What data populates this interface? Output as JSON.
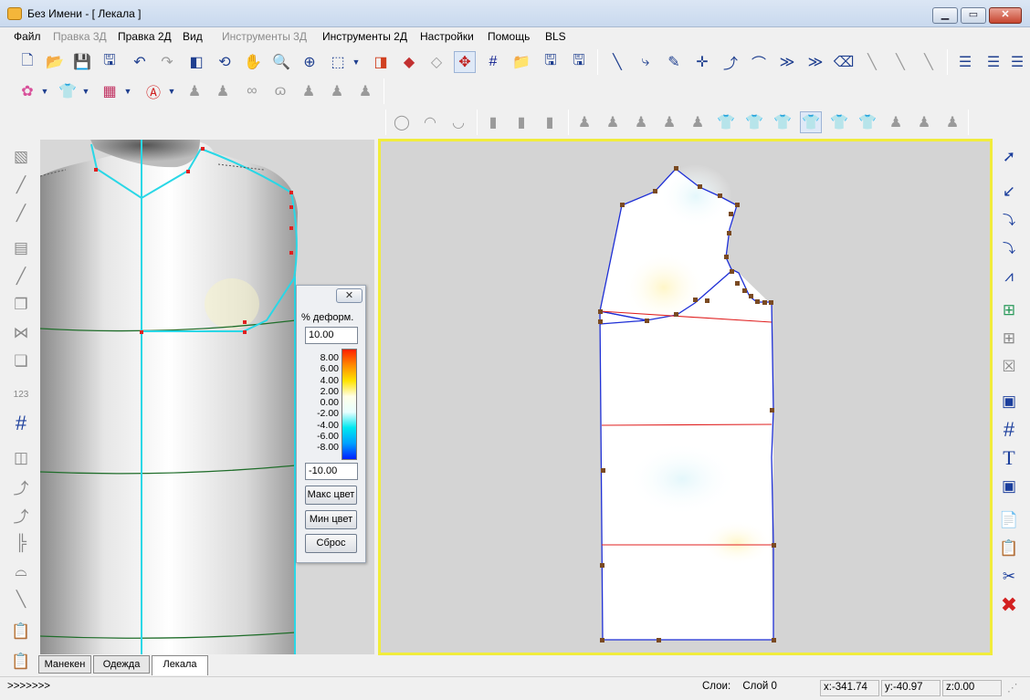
{
  "window": {
    "title": "Без Имени  - [  Лекала  ]",
    "controls": {
      "minimize": "▁",
      "maximize": "▭",
      "close": "✕"
    }
  },
  "menu": [
    {
      "label": "Файл",
      "enabled": true
    },
    {
      "label": "Правка 3Д",
      "enabled": false
    },
    {
      "label": "Правка 2Д",
      "enabled": true
    },
    {
      "label": "Вид",
      "enabled": true
    },
    {
      "label": "Инструменты 3Д",
      "enabled": false
    },
    {
      "label": "Инструменты 2Д",
      "enabled": true
    },
    {
      "label": "Настройки",
      "enabled": true
    },
    {
      "label": "Помощь",
      "enabled": true
    },
    {
      "label": "BLS",
      "enabled": true
    }
  ],
  "deform_panel": {
    "close_label": "✕",
    "label": "% деформ.",
    "max_value": "10.00",
    "min_value": "-10.00",
    "scale_ticks": [
      "8.00",
      "6.00",
      "4.00",
      "2.00",
      "0.00",
      "-2.00",
      "-4.00",
      "-6.00",
      "-8.00"
    ],
    "max_color_button": "Макс цвет",
    "min_color_button": "Мин цвет",
    "reset_button": "Сброс"
  },
  "tabs": [
    {
      "label": "Манекен",
      "active": false
    },
    {
      "label": "Одежда",
      "active": false
    },
    {
      "label": "Лекала",
      "active": true
    }
  ],
  "status": {
    "prompt": ">>>>>>>",
    "layers_label": "Слои:",
    "layer_value": "Слой  0",
    "x": "x:-341.74",
    "y": "y:-40.97",
    "z": "z:0.00"
  },
  "colors": {
    "accent_frame": "#f1ec3c",
    "pattern_outline": "#1e2fd6",
    "grid_line_red": "#e02020",
    "anchor_point": "#7a4a22",
    "mannequin_cut": "#29d7e6"
  },
  "icons": {
    "toolbar1": [
      "new-file-icon",
      "open-folder-icon",
      "save-icon",
      "save-as-icon",
      "undo-icon",
      "redo-icon",
      "view-split-icon",
      "rotate-icon",
      "pan-hand-icon",
      "zoom-icon",
      "zoom-window-icon",
      "view-3d-icon",
      "shading-icon",
      "texture-icon",
      "mesh-icon",
      "move-center-icon",
      "grid-icon",
      "open-tp-icon",
      "save-tp-icon",
      "save-tp-as-icon",
      "line-icon",
      "curve-icon",
      "pencil-icon",
      "point-icon",
      "bezier-add-icon",
      "arc-icon",
      "multi-arc-icon",
      "multi-arc-add-icon",
      "eraser-icon",
      "dart-icon",
      "ruler-icon",
      "ruler2-icon",
      "spacing-icon",
      "spacing2-icon",
      "spacing3-icon"
    ],
    "toolbar2": [
      "flower-material-icon",
      "shirt-icon",
      "color-grid-icon",
      "avatar-icon",
      "body-torso-icon",
      "body-torso2-icon",
      "body-bra-icon",
      "body-hips-icon",
      "body-leg-icon",
      "body-arm-icon",
      "body-full-icon"
    ],
    "toolbar3": [
      "collar-icon",
      "collar2-icon",
      "collar3-icon",
      "pants-icon",
      "pants2-icon",
      "pants3-icon",
      "torso-a-icon",
      "torso-b-icon",
      "torso-c-icon",
      "torso-d-icon",
      "torso-e-icon",
      "shirt-outline-icon",
      "shirt-outline2-icon",
      "shirt-front-icon",
      "shirt-back-icon",
      "shirt-outline3-icon",
      "shirt-outline4-icon",
      "jacket-icon",
      "vest-icon",
      "torso-f-icon"
    ],
    "left_tools": [
      "mannequin-view-icon",
      "brush-icon",
      "brush-alt-icon",
      "texture-tool-icon",
      "line-tool-icon",
      "copy-tool-icon",
      "mirror-tool-icon",
      "layers-tool-icon",
      "measure-tool-icon",
      "grid-tool-icon",
      "split-tool-icon",
      "curve-add-icon",
      "curve-add2-icon",
      "align-tool-icon",
      "arc-tool-icon",
      "ruler-tool-icon",
      "paste-icon",
      "paste2-icon"
    ],
    "right_tools": [
      "select-arrow-icon",
      "line-arrow-icon",
      "mirror-x-icon",
      "mirror-y-icon",
      "measure-a-icon",
      "add-point-icon",
      "add-point2-icon",
      "delete-point-icon",
      "fabric-icon",
      "grid-icon",
      "text-icon",
      "fabric2-icon",
      "copy-icon",
      "paste-icon",
      "cut-icon",
      "delete-icon"
    ]
  }
}
